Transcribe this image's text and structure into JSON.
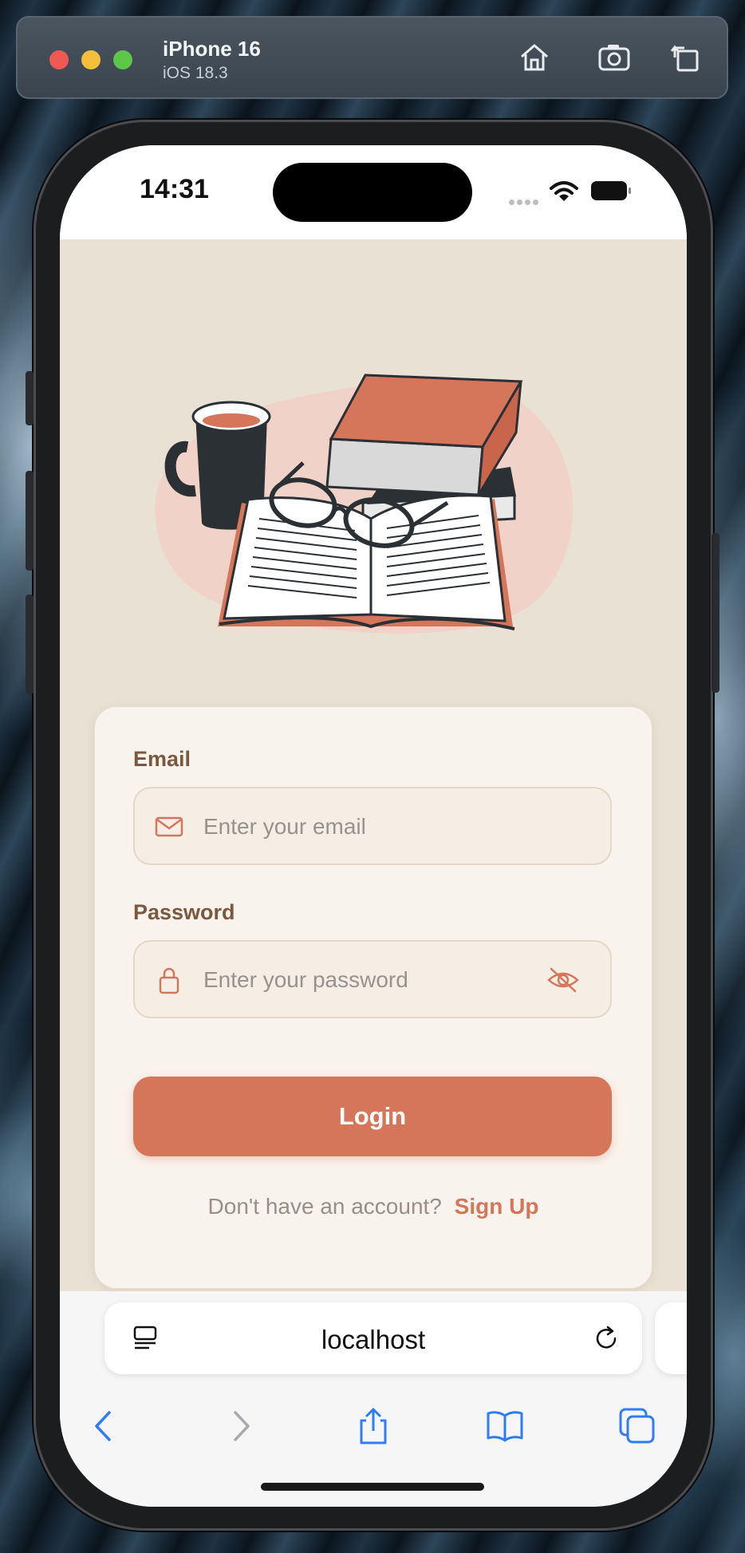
{
  "simulator": {
    "device_name": "iPhone 16",
    "os_version": "iOS 18.3",
    "toolbar_icons": [
      "home-icon",
      "screenshot-icon",
      "rotate-icon"
    ]
  },
  "status_bar": {
    "time": "14:31",
    "icons": [
      "cellular-icon",
      "wifi-icon",
      "battery-icon"
    ]
  },
  "illustration": {
    "subject": "books-mug-glasses-illustration",
    "colors": {
      "accent": "#d5765b",
      "blob": "#f0d2c8",
      "dark": "#2b3034"
    }
  },
  "login_form": {
    "email": {
      "label": "Email",
      "placeholder": "Enter your email",
      "value": ""
    },
    "password": {
      "label": "Password",
      "placeholder": "Enter your password",
      "value": ""
    },
    "login_button": "Login",
    "signup_prompt": "Don't have an account?",
    "signup_link": "Sign Up"
  },
  "browser": {
    "url": "localhost",
    "toolbar": [
      "back-icon",
      "forward-icon",
      "share-icon",
      "bookmarks-icon",
      "tabs-icon"
    ]
  },
  "colors": {
    "background": "#e9e1d4",
    "card": "#f8f3ec",
    "accent": "#d5765b",
    "label": "#7b5840",
    "ios_blue": "#2f7cf6"
  }
}
